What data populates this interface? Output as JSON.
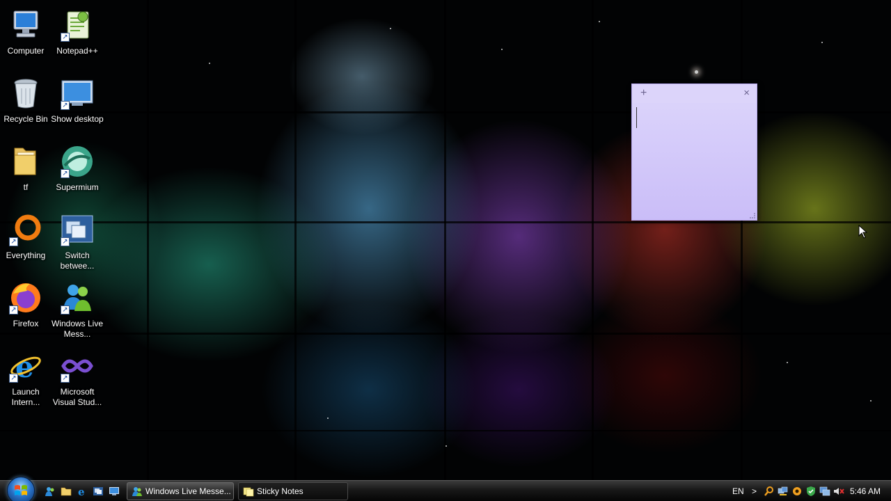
{
  "desktop": {
    "icons": [
      {
        "label": "Computer",
        "icon": "computer-icon"
      },
      {
        "label": "Notepad++",
        "icon": "notepad-plus-plus-icon"
      },
      {
        "label": "Recycle Bin",
        "icon": "recycle-bin-icon"
      },
      {
        "label": "Show desktop",
        "icon": "show-desktop-icon"
      },
      {
        "label": "tf",
        "icon": "folder-icon"
      },
      {
        "label": "Supermium",
        "icon": "supermium-icon"
      },
      {
        "label": "Everything",
        "icon": "everything-icon"
      },
      {
        "label": "Switch betwee...",
        "icon": "switch-windows-icon"
      },
      {
        "label": "Firefox",
        "icon": "firefox-icon"
      },
      {
        "label": "Windows Live Mess...",
        "icon": "windows-live-messenger-icon"
      },
      {
        "label": "Launch Intern...",
        "icon": "internet-explorer-icon"
      },
      {
        "label": "Microsoft Visual Stud...",
        "icon": "visual-studio-icon"
      }
    ]
  },
  "sticky_note": {
    "add_glyph": "+",
    "close_glyph": "×",
    "color": "#d6cefa"
  },
  "taskbar": {
    "start_icon": "windows-logo-icon",
    "quicklaunch": [
      "messenger-icon",
      "folder-icon",
      "internet-explorer-icon",
      "switch-windows-icon",
      "show-desktop-icon"
    ],
    "tasks": [
      {
        "label": "Windows Live Messe...",
        "icon": "windows-live-messenger-icon"
      },
      {
        "label": "Sticky Notes",
        "icon": "sticky-notes-icon"
      }
    ],
    "tray": {
      "language": "EN",
      "expand_glyph": ">",
      "icons": [
        "search-icon",
        "network-icon",
        "settings-icon",
        "security-icon",
        "display-icon",
        "volume-muted-icon"
      ],
      "time": "5:46 AM"
    }
  },
  "colors": {
    "taskbar": "#1a1a1a",
    "sticky": "#d6cefa",
    "start_orb": "#2a73c9"
  }
}
